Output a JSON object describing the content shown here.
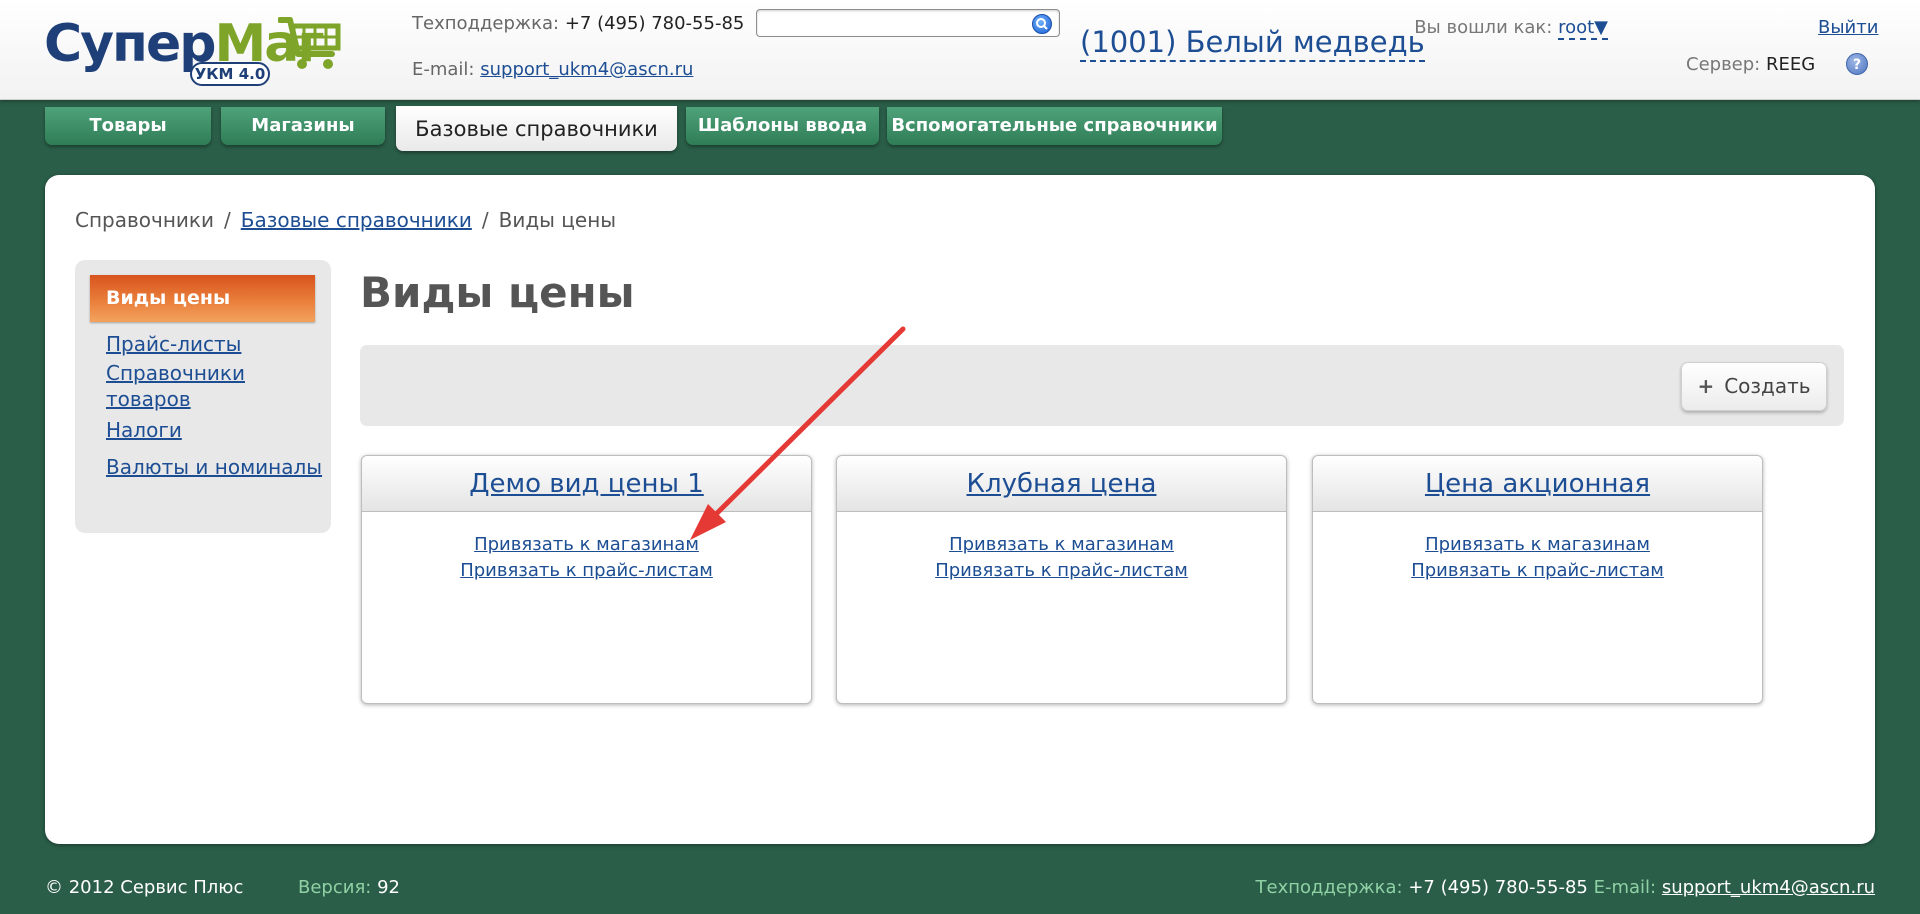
{
  "header": {
    "logo": {
      "part1": "Супер",
      "part2": "Маг",
      "badge": "УКМ 4.0"
    },
    "support_phone_label": "Техподдержка:",
    "support_phone": "+7 (495) 780-55-85",
    "email_label": "E-mail:",
    "email": "support_ukm4@ascn.ru",
    "search": {
      "value": "",
      "placeholder": ""
    },
    "store_name": "(1001) Белый медведь",
    "login_label": "Вы вошли как:",
    "user": "root",
    "user_caret": "▼",
    "logout": "Выйти",
    "server_label": "Сервер:",
    "server": "REEG",
    "help": "?"
  },
  "tabs": [
    {
      "label": "Товары"
    },
    {
      "label": "Магазины"
    },
    {
      "label": "Базовые справочники"
    },
    {
      "label": "Шаблоны ввода"
    },
    {
      "label": "Вспомогательные справочники"
    }
  ],
  "breadcrumb": {
    "root": "Справочники",
    "sep": "/",
    "parent": "Базовые справочники",
    "current": "Виды цены"
  },
  "sidebar": {
    "active": "Виды цены",
    "items": [
      {
        "label": "Прайс-листы"
      },
      {
        "label": "Справочники товаров"
      },
      {
        "label": "Налоги"
      },
      {
        "label": "Валюты и номиналы"
      }
    ]
  },
  "page": {
    "title": "Виды цены",
    "create_icon": "+",
    "create_label": "Создать"
  },
  "cards": [
    {
      "title": "Демо вид цены 1",
      "link1": "Привязать к магазинам",
      "link2": "Привязать к прайс-листам"
    },
    {
      "title": "Клубная цена",
      "link1": "Привязать к магазинам",
      "link2": "Привязать к прайс-листам"
    },
    {
      "title": "Цена акционная",
      "link1": "Привязать к магазинам",
      "link2": "Привязать к прайс-листам"
    }
  ],
  "footer": {
    "copyright": "© 2012 Сервис Плюс",
    "version_label": "Версия:",
    "version": "92",
    "support_label": "Техподдержка:",
    "support_phone": "+7 (495) 780-55-85",
    "email_label": "E-mail:",
    "email": "support_ukm4@ascn.ru"
  },
  "colors": {
    "background": "#2a5e48",
    "tab": "#3d8f66",
    "link": "#1d4e94",
    "sidebar_active": "#e2682a",
    "annotation_arrow": "#e53935"
  },
  "icons": {
    "logo": "cart-icon",
    "search": "search-icon",
    "help": "help-icon",
    "create": "plus-icon",
    "annotation": "red-arrow"
  }
}
